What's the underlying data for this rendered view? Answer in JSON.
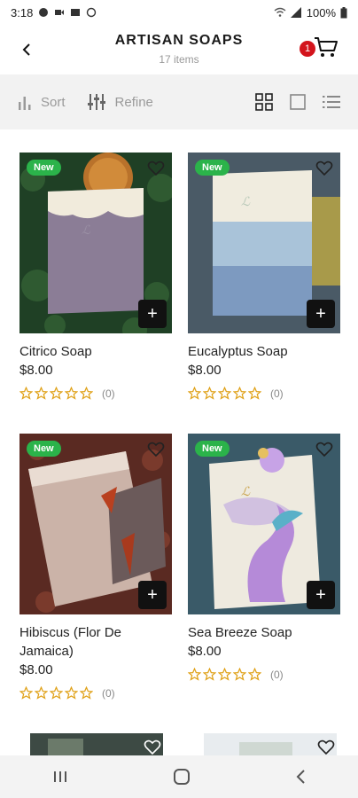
{
  "status": {
    "time": "3:18",
    "battery": "100%"
  },
  "header": {
    "title": "ARTISAN SOAPS",
    "subtitle": "17 items",
    "cart_count": "1"
  },
  "toolbar": {
    "sort_label": "Sort",
    "refine_label": "Refine"
  },
  "products": [
    {
      "name": "Citrico Soap",
      "price": "$8.00",
      "badge": "New",
      "rating_count": "(0)"
    },
    {
      "name": "Eucalyptus Soap",
      "price": "$8.00",
      "badge": "New",
      "rating_count": "(0)"
    },
    {
      "name": "Hibiscus (Flor De Jamaica)",
      "price": "$8.00",
      "badge": "New",
      "rating_count": "(0)"
    },
    {
      "name": "Sea Breeze Soap",
      "price": "$8.00",
      "badge": "New",
      "rating_count": "(0)"
    }
  ],
  "colors": {
    "accent": "#d3141c",
    "new_badge": "#2bb34a",
    "star": "#e0a21a"
  },
  "icons": [
    "back-arrow-icon",
    "cart-icon",
    "sort-icon",
    "refine-icon",
    "grid-view-icon",
    "single-view-icon",
    "list-view-icon",
    "heart-icon",
    "plus-icon",
    "star-icon"
  ]
}
